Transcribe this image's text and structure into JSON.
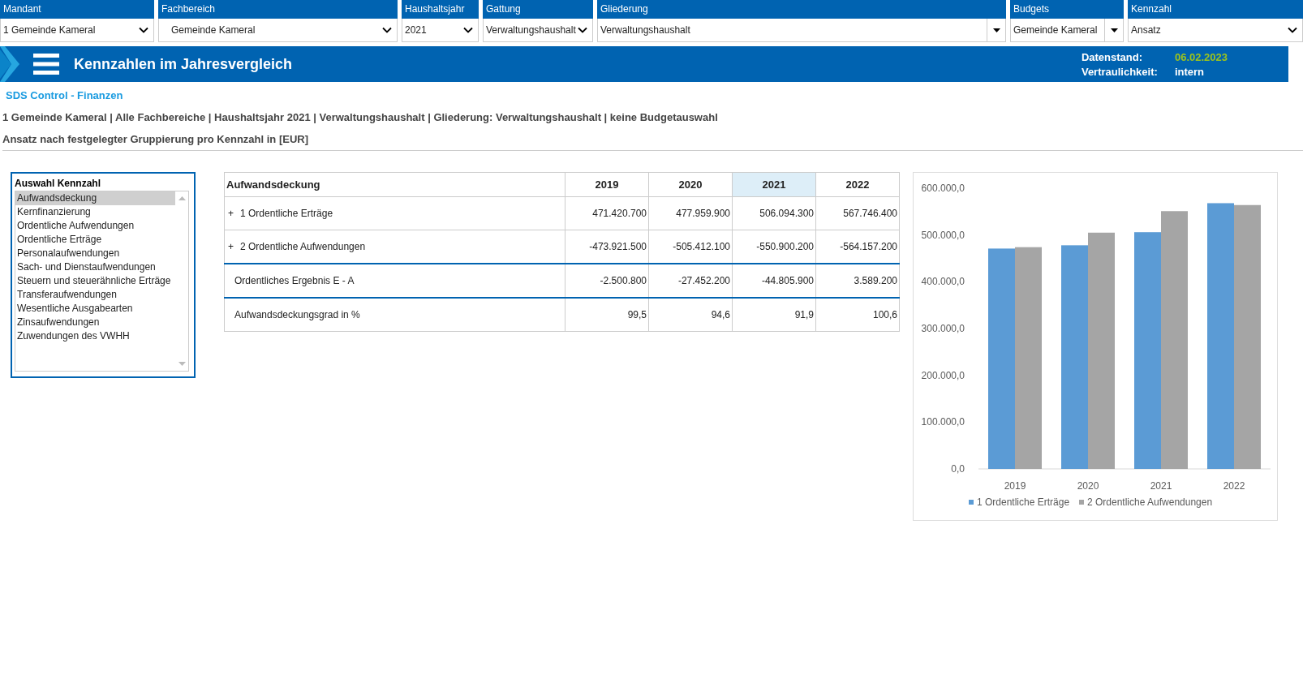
{
  "filters": [
    {
      "label": "Mandant",
      "value": "1 Gemeinde Kameral",
      "kind": "chevron"
    },
    {
      "label": "Fachbereich",
      "value": "Gemeinde Kameral",
      "kind": "chevron"
    },
    {
      "label": "Haushaltsjahr",
      "value": "2021",
      "kind": "chevron"
    },
    {
      "label": "Gattung",
      "value": "Verwaltungshaushalt",
      "kind": "chevron"
    },
    {
      "label": "Gliederung",
      "value": "Verwaltungshaushalt",
      "kind": "button"
    },
    {
      "label": "Budgets",
      "value": "Gemeinde Kameral",
      "kind": "button"
    },
    {
      "label": "Kennzahl",
      "value": "Ansatz",
      "kind": "chevron"
    }
  ],
  "header": {
    "title": "Kennzahlen im Jahresvergleich",
    "info": [
      {
        "label": "Datenstand:",
        "value": "06.02.2023",
        "color": "#9cc31c"
      },
      {
        "label": "Vertraulichkeit:",
        "value": "intern",
        "color": "#ffffff"
      }
    ]
  },
  "app_name": "SDS Control - Finanzen",
  "breadcrumb": "1 Gemeinde Kameral | Alle Fachbereiche | Haushaltsjahr 2021 | Verwaltungshaushalt | Gliederung: Verwaltungshaushalt | keine Budgetauswahl",
  "subtitle": "Ansatz nach festgelegter Gruppierung pro Kennzahl in [EUR]",
  "selector": {
    "title": "Auswahl Kennzahl",
    "items": [
      {
        "label": "Aufwandsdeckung",
        "selected": true
      },
      {
        "label": "Kernfinanzierung",
        "selected": false
      },
      {
        "label": "Ordentliche Aufwendungen",
        "selected": false
      },
      {
        "label": "Ordentliche Erträge",
        "selected": false
      },
      {
        "label": "Personalaufwendungen",
        "selected": false
      },
      {
        "label": "Sach- und Dienstaufwendungen",
        "selected": false
      },
      {
        "label": "Steuern und steuerähnliche Erträge",
        "selected": false
      },
      {
        "label": "Transferaufwendungen",
        "selected": false
      },
      {
        "label": "Wesentliche Ausgabearten",
        "selected": false
      },
      {
        "label": "Zinsaufwendungen",
        "selected": false
      },
      {
        "label": "Zuwendungen des VWHH",
        "selected": false
      }
    ]
  },
  "table": {
    "columns": [
      {
        "label": "Aufwandsdeckung",
        "selected": false
      },
      {
        "label": "2019",
        "selected": false
      },
      {
        "label": "2020",
        "selected": false
      },
      {
        "label": "2021",
        "selected": true
      },
      {
        "label": "2022",
        "selected": false
      }
    ],
    "rows": [
      {
        "kind": "group",
        "toggle": "+",
        "label": "1 Ordentliche Erträge",
        "values": [
          "471.420.700",
          "477.959.900",
          "506.094.300",
          "567.746.400"
        ]
      },
      {
        "kind": "group",
        "toggle": "+",
        "label": "2 Ordentliche Aufwendungen",
        "values": [
          "-473.921.500",
          "-505.412.100",
          "-550.900.200",
          "-564.157.200"
        ]
      },
      {
        "kind": "result",
        "label": "Ordentliches Ergebnis E - A",
        "values": [
          "-2.500.800",
          "-27.452.200",
          "-44.805.900",
          "3.589.200"
        ]
      },
      {
        "kind": "result",
        "label": "Aufwandsdeckungsgrad in %",
        "values": [
          "99,5",
          "94,6",
          "91,9",
          "100,6"
        ]
      }
    ]
  },
  "chart": {
    "chart_data": {
      "type": "bar",
      "categories": [
        "2019",
        "2020",
        "2021",
        "2022"
      ],
      "series": [
        {
          "name": "1 Ordentliche Erträge",
          "color": "#5b9bd5",
          "values": [
            471000,
            478000,
            506000,
            568000
          ]
        },
        {
          "name": "2 Ordentliche Aufwendungen",
          "color": "#a5a5a5",
          "values": [
            474000,
            505000,
            551000,
            564000
          ]
        }
      ],
      "legend": "bottom",
      "ylim": [
        0,
        600000
      ],
      "yticks": [
        {
          "value": 0,
          "label": "0,0"
        },
        {
          "value": 100000,
          "label": "100.000,0"
        },
        {
          "value": 200000,
          "label": "200.000,0"
        },
        {
          "value": 300000,
          "label": "300.000,0"
        },
        {
          "value": 400000,
          "label": "400.000,0"
        },
        {
          "value": 500000,
          "label": "500.000,0"
        },
        {
          "value": 600000,
          "label": "600.000,0"
        }
      ]
    }
  }
}
